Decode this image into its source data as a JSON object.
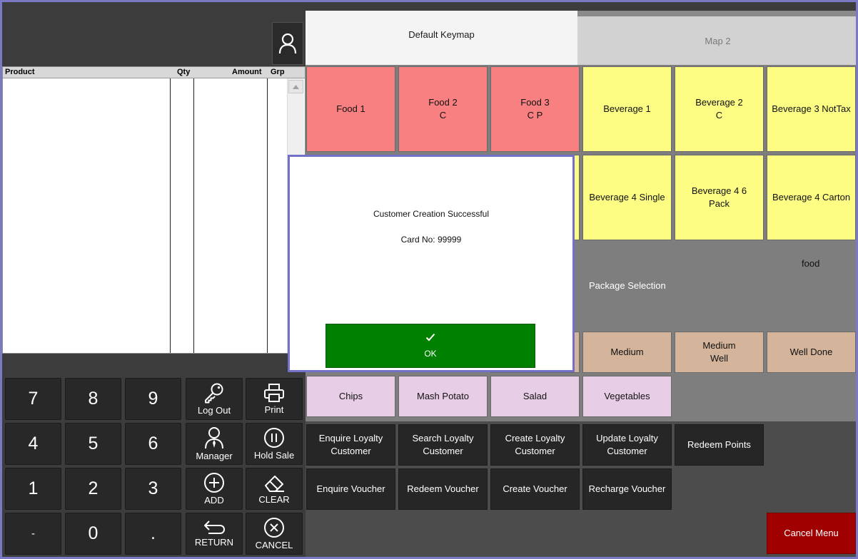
{
  "order_table": {
    "columns": [
      "Product",
      "Qty",
      "Amount",
      "Grp"
    ]
  },
  "keypad": {
    "digits": [
      "7",
      "8",
      "9",
      "4",
      "5",
      "6",
      "1",
      "2",
      "3",
      "-",
      "0",
      "."
    ],
    "actions": [
      {
        "label": "Log Out",
        "icon": "key-icon"
      },
      {
        "label": "Print",
        "icon": "printer-icon"
      },
      {
        "label": "Manager",
        "icon": "manager-icon"
      },
      {
        "label": "Hold Sale",
        "icon": "pause-icon"
      },
      {
        "label": "ADD",
        "icon": "plus-circle-icon"
      },
      {
        "label": "CLEAR",
        "icon": "eraser-icon"
      },
      {
        "label": "RETURN",
        "icon": "return-arrow-icon"
      },
      {
        "label": "CANCEL",
        "icon": "x-circle-icon"
      }
    ]
  },
  "tabs": {
    "default_keymap": "Default Keymap",
    "map2": "Map 2"
  },
  "product_buttons": {
    "row1": [
      "Food 1",
      "Food 2\nC",
      "Food 3\nC P",
      "Beverage 1",
      "Beverage 2\nC",
      "Beverage 3 NotTax"
    ],
    "row2": [
      "Beverage 4 Single",
      "Beverage 4 6\nPack",
      "Beverage 4 Carton"
    ],
    "food_label": "food",
    "package_selection": "Package Selection",
    "doneness": [
      "Medium",
      "Medium\nWell",
      "Well Done"
    ],
    "sides": [
      "Chips",
      "Mash Potato",
      "Salad",
      "Vegetables"
    ]
  },
  "loyalty_buttons": {
    "row1": [
      "Enquire Loyalty\nCustomer",
      "Search Loyalty\nCustomer",
      "Create Loyalty\nCustomer",
      "Update Loyalty\nCustomer",
      "Redeem Points"
    ],
    "row2": [
      "Enquire Voucher",
      "Redeem Voucher",
      "Create Voucher",
      "Recharge Voucher"
    ],
    "cancel_menu": "Cancel Menu"
  },
  "dialog": {
    "message": "Customer Creation Successful",
    "card": "Card No: 99999",
    "ok_label": "OK"
  },
  "colors": {
    "food": "#f98080",
    "beverage": "#fdfd84",
    "doneness": "#d4b49a",
    "sides": "#e8cde6",
    "ok": "#008000",
    "cancel_menu": "#a10000",
    "dialog_border": "#7270c8"
  }
}
